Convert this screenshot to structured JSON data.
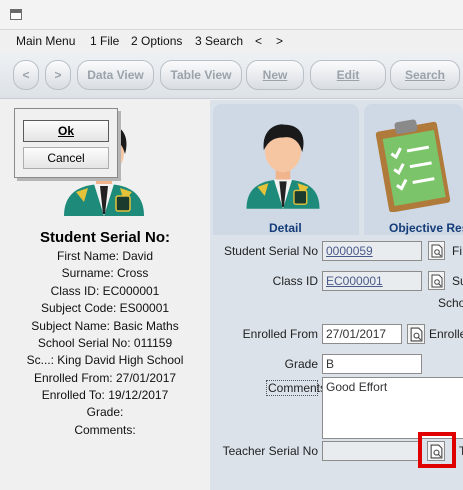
{
  "menu": {
    "items": [
      "Main Menu",
      "1 File",
      "2 Options",
      "3 Search",
      "<",
      ">"
    ]
  },
  "toolbar": {
    "prev_label": "<",
    "next_label": ">",
    "data_view": "Data View",
    "table_view": "Table View",
    "new": "New",
    "edit": "Edit",
    "search": "Search"
  },
  "dialog": {
    "ok": "Ok",
    "cancel": "Cancel"
  },
  "student_info": {
    "title": "Student Serial No:",
    "lines": [
      "First Name: David",
      "Surname: Cross",
      "Class ID: EC000001",
      "Subject Code: ES00001",
      "Subject Name: Basic Maths",
      "School Serial No: 011159",
      "Sc...: King David High School",
      "Enrolled From: 27/01/2017",
      "Enrolled To: 19/12/2017",
      "Grade:",
      "Comments:"
    ]
  },
  "tabs": {
    "detail": "Detail",
    "objective": "Objective Res"
  },
  "form": {
    "student_serial_label": "Student Serial No",
    "student_serial_value": "0000059",
    "student_serial_side": "Fi",
    "class_id_label": "Class ID",
    "class_id_value": "EC000001",
    "class_id_side": "Su",
    "school_side": "Schoo",
    "enrolled_from_label": "Enrolled From",
    "enrolled_from_value": "27/01/2017",
    "enrolled_side": "Enrolled",
    "grade_label": "Grade",
    "grade_value": "B",
    "comments_label": "Comments",
    "comments_value": "Good Effort",
    "teacher_serial_label": "Teacher Serial No",
    "teacher_side": "T"
  },
  "colors": {
    "highlight": "#e00000",
    "tab_label": "#143c78",
    "uniform_green": "#1d8a7a"
  }
}
